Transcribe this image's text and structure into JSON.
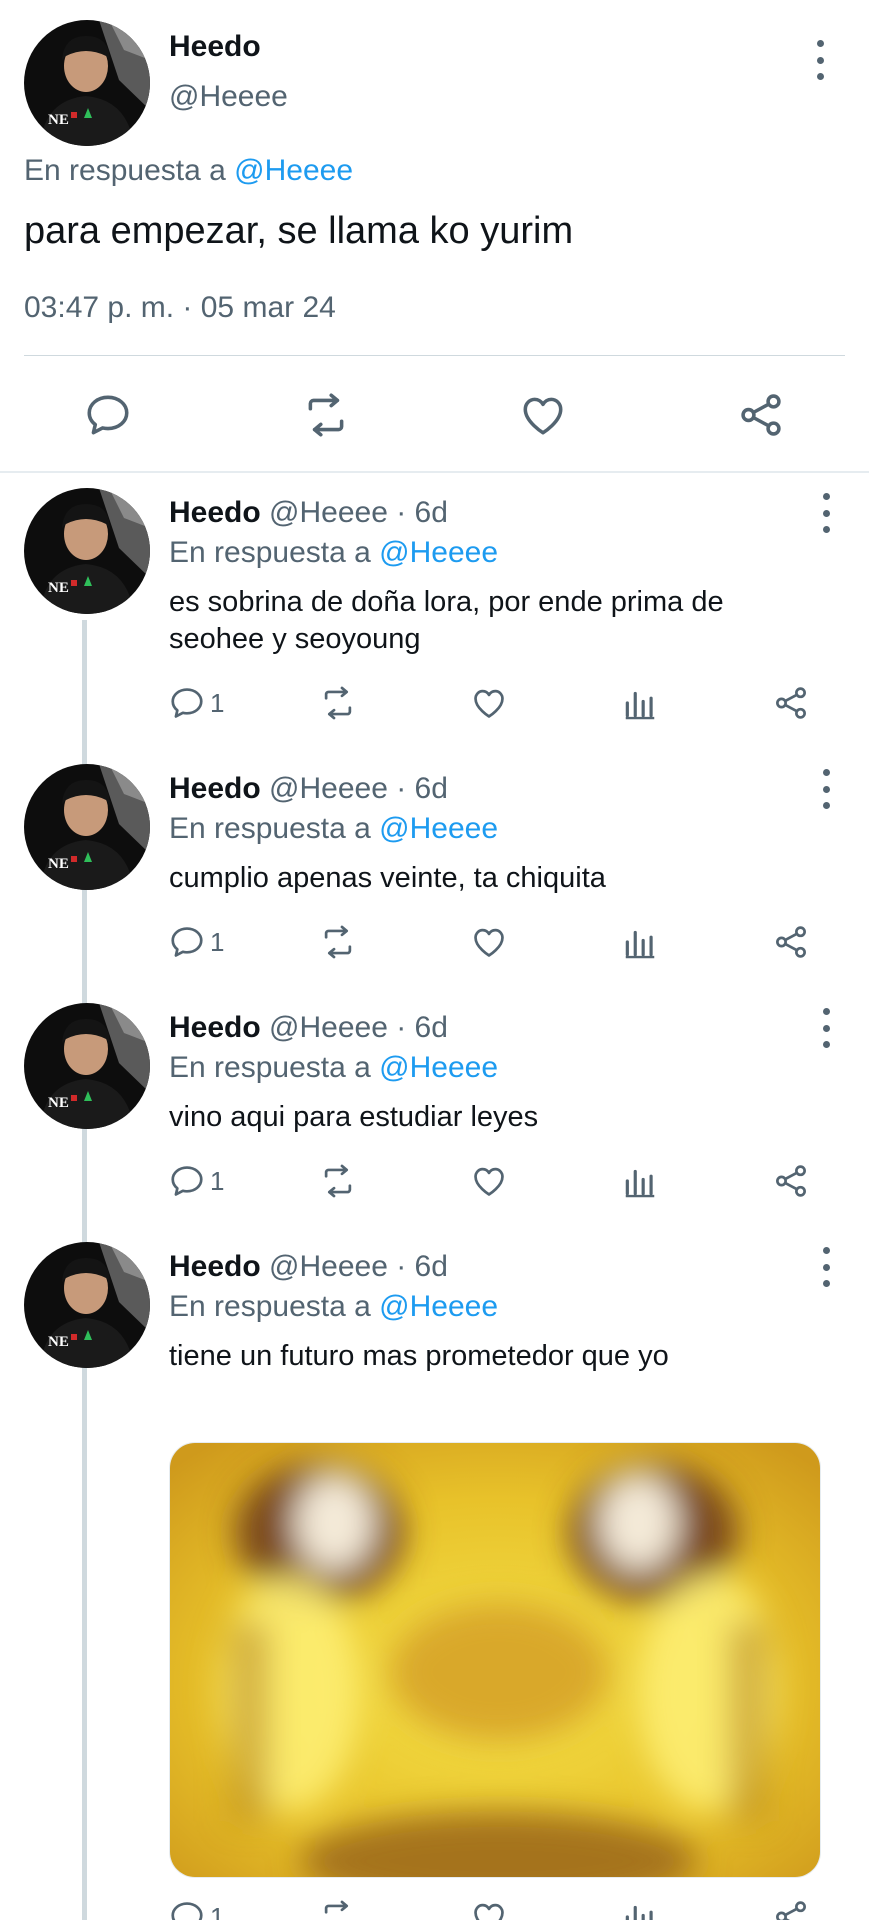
{
  "author": {
    "name": "Heedo",
    "handle": "@Heeee"
  },
  "main_tweet": {
    "reply_prefix": "En respuesta a",
    "reply_to": "@Heeee",
    "text": "para empezar, se llama ko yurim",
    "timestamp": "03:47 p. m. · 05 mar 24",
    "actions": [
      "reply-icon",
      "retweet-icon",
      "like-icon",
      "share-icon"
    ]
  },
  "replies": [
    {
      "name": "Heedo",
      "meta": "@Heeee · 6d",
      "reply_prefix": "En respuesta a",
      "reply_to": "@Heeee",
      "text": "es sobrina de doña lora, por ende prima de seohee y seoyoung",
      "reply_count": "1"
    },
    {
      "name": "Heedo",
      "meta": "@Heeee · 6d",
      "reply_prefix": "En respuesta a",
      "reply_to": "@Heeee",
      "text": "cumplio apenas veinte, ta chiquita",
      "reply_count": "1"
    },
    {
      "name": "Heedo",
      "meta": "@Heeee · 6d",
      "reply_prefix": "En respuesta a",
      "reply_to": "@Heeee",
      "text": "vino aqui para estudiar leyes",
      "reply_count": "1"
    },
    {
      "name": "Heedo",
      "meta": "@Heeee · 6d",
      "reply_prefix": "En respuesta a",
      "reply_to": "@Heeee",
      "text": "tiene un futuro mas prometedor que yo",
      "reply_count": "1"
    }
  ],
  "colors": {
    "accent": "#1d9bf0",
    "secondary_text": "#536471",
    "divider": "#cfd9de"
  }
}
